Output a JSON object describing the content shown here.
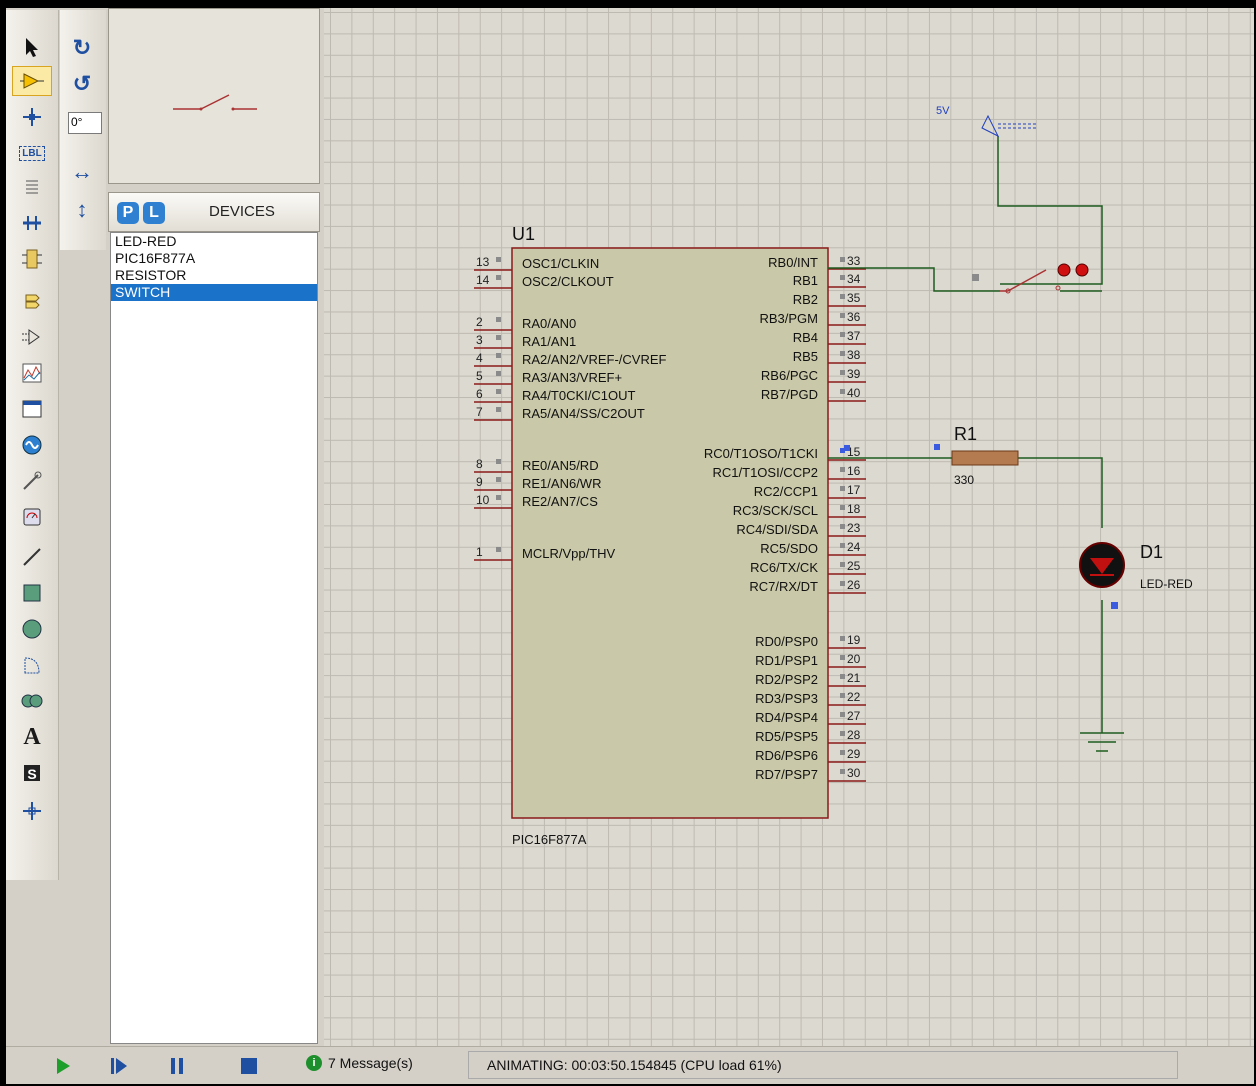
{
  "toolbar_left": {
    "tools": [
      "selection-icon",
      "component-icon",
      "junction-icon",
      "label-icon",
      "text-script-icon",
      "buses-icon",
      "subcircuit-icon",
      "terminal-icon",
      "pin-icon",
      "graph-icon",
      "tape-recorder-icon",
      "generator-icon",
      "voltage-probe-icon",
      "virtual-instrument-icon",
      "line-icon",
      "box-icon",
      "circle-icon",
      "arc-icon",
      "path-icon",
      "text-icon",
      "symbol-icon",
      "marker-icon"
    ],
    "selected": "component-icon",
    "text_label": "A",
    "lbl_label": "LBL"
  },
  "toolbar_rotate": {
    "angle_value": "0°"
  },
  "devices": {
    "p_label": "P",
    "l_label": "L",
    "title": "DEVICES",
    "items": [
      "LED-RED",
      "PIC16F877A",
      "RESISTOR",
      "SWITCH"
    ],
    "selected": "SWITCH"
  },
  "schematic": {
    "mcu": {
      "ref": "U1",
      "part": "PIC16F877A",
      "left_pins": [
        {
          "num": "13",
          "name": "OSC1/CLKIN"
        },
        {
          "num": "14",
          "name": "OSC2/CLKOUT"
        },
        {
          "num": "2",
          "name": "RA0/AN0"
        },
        {
          "num": "3",
          "name": "RA1/AN1"
        },
        {
          "num": "4",
          "name": "RA2/AN2/VREF-/CVREF"
        },
        {
          "num": "5",
          "name": "RA3/AN3/VREF+"
        },
        {
          "num": "6",
          "name": "RA4/T0CKI/C1OUT"
        },
        {
          "num": "7",
          "name": "RA5/AN4/SS/C2OUT"
        },
        {
          "num": "8",
          "name": "RE0/AN5/RD"
        },
        {
          "num": "9",
          "name": "RE1/AN6/WR"
        },
        {
          "num": "10",
          "name": "RE2/AN7/CS"
        },
        {
          "num": "1",
          "name": "MCLR/Vpp/THV"
        }
      ],
      "right_pins": [
        {
          "num": "33",
          "name": "RB0/INT"
        },
        {
          "num": "34",
          "name": "RB1"
        },
        {
          "num": "35",
          "name": "RB2"
        },
        {
          "num": "36",
          "name": "RB3/PGM"
        },
        {
          "num": "37",
          "name": "RB4"
        },
        {
          "num": "38",
          "name": "RB5"
        },
        {
          "num": "39",
          "name": "RB6/PGC"
        },
        {
          "num": "40",
          "name": "RB7/PGD"
        },
        {
          "num": "15",
          "name": "RC0/T1OSO/T1CKI"
        },
        {
          "num": "16",
          "name": "RC1/T1OSI/CCP2"
        },
        {
          "num": "17",
          "name": "RC2/CCP1"
        },
        {
          "num": "18",
          "name": "RC3/SCK/SCL"
        },
        {
          "num": "23",
          "name": "RC4/SDI/SDA"
        },
        {
          "num": "24",
          "name": "RC5/SDO"
        },
        {
          "num": "25",
          "name": "RC6/TX/CK"
        },
        {
          "num": "26",
          "name": "RC7/RX/DT"
        },
        {
          "num": "19",
          "name": "RD0/PSP0"
        },
        {
          "num": "20",
          "name": "RD1/PSP1"
        },
        {
          "num": "21",
          "name": "RD2/PSP2"
        },
        {
          "num": "22",
          "name": "RD3/PSP3"
        },
        {
          "num": "27",
          "name": "RD4/PSP4"
        },
        {
          "num": "28",
          "name": "RD5/PSP5"
        },
        {
          "num": "29",
          "name": "RD6/PSP6"
        },
        {
          "num": "30",
          "name": "RD7/PSP7"
        }
      ]
    },
    "power_label": "5V",
    "resistor": {
      "ref": "R1",
      "value": "330"
    },
    "led": {
      "ref": "D1",
      "part": "LED-RED"
    }
  },
  "status": {
    "messages": "7 Message(s)",
    "animation": "ANIMATING: 00:03:50.154845 (CPU load 61%)"
  },
  "colors": {
    "wire": "#1f5c1f",
    "component_outline": "#8b1a1a",
    "component_fill": "#c9c8a8",
    "selection": "#1a72c9",
    "grid": "#bdbab2"
  }
}
